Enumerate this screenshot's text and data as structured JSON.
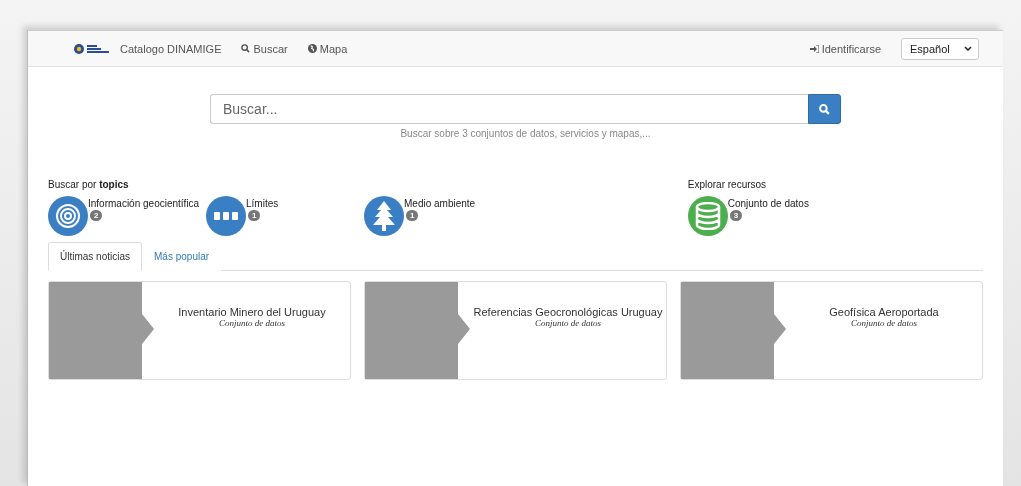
{
  "navbar": {
    "brand": "Catalogo DINAMIGE",
    "links": [
      {
        "label": "Buscar",
        "kind": "search"
      },
      {
        "label": "Mapa",
        "kind": "globe"
      }
    ],
    "login": "Identificarse",
    "language": "Español"
  },
  "search": {
    "placeholder": "Buscar...",
    "hint": "Buscar sobre 3 conjuntos de datos, servicios y mapas,..."
  },
  "topics": {
    "heading": "Buscar por **topics**",
    "items": [
      {
        "label": "Información geocientífica",
        "count": "2",
        "kind": "rings"
      },
      {
        "label": "Límites",
        "count": "1",
        "kind": "dots"
      },
      {
        "label": "Medio ambiente",
        "count": "1",
        "kind": "tree"
      }
    ]
  },
  "resources": {
    "heading": "Explorar recursos",
    "items": [
      {
        "label": "Conjunto de datos",
        "count": "3",
        "kind": "database"
      }
    ]
  },
  "tabs": [
    {
      "label": "Últimas noticias",
      "selected": true
    },
    {
      "label": "Más popular",
      "selected": false
    }
  ],
  "cards": [
    {
      "title": "Inventario Minero del Uruguay",
      "type": "Conjunto de datos"
    },
    {
      "title": "Referencias Geocronológicas Uruguay",
      "type": "Conjunto de datos"
    },
    {
      "title": "Geofísica Aeroportada",
      "type": "Conjunto de datos"
    }
  ]
}
